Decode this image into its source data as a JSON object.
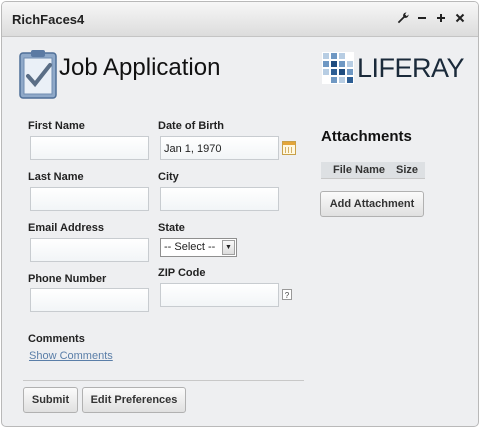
{
  "window": {
    "title": "RichFaces4",
    "tools": [
      "wrench-icon",
      "minimize-icon",
      "maximize-icon",
      "close-icon"
    ]
  },
  "header": {
    "title": "Job Application",
    "logo_text": "LIFERAY"
  },
  "form": {
    "first_name_label": "First Name",
    "first_name_value": "",
    "dob_label": "Date of Birth",
    "dob_value": "Jan 1, 1970",
    "last_name_label": "Last Name",
    "last_name_value": "",
    "city_label": "City",
    "city_value": "",
    "email_label": "Email Address",
    "email_value": "",
    "state_label": "State",
    "state_selected": "-- Select --",
    "phone_label": "Phone Number",
    "phone_value": "",
    "zip_label": "ZIP Code",
    "zip_value": "",
    "zip_help": "?",
    "comments_label": "Comments",
    "show_comments_link": "Show Comments"
  },
  "buttons": {
    "submit": "Submit",
    "edit_preferences": "Edit Preferences"
  },
  "attachments": {
    "title": "Attachments",
    "columns": [
      "File Name",
      "Size"
    ],
    "add_button": "Add Attachment"
  },
  "colors": {
    "link": "#5a7ea8",
    "background": "#eeeff1"
  }
}
